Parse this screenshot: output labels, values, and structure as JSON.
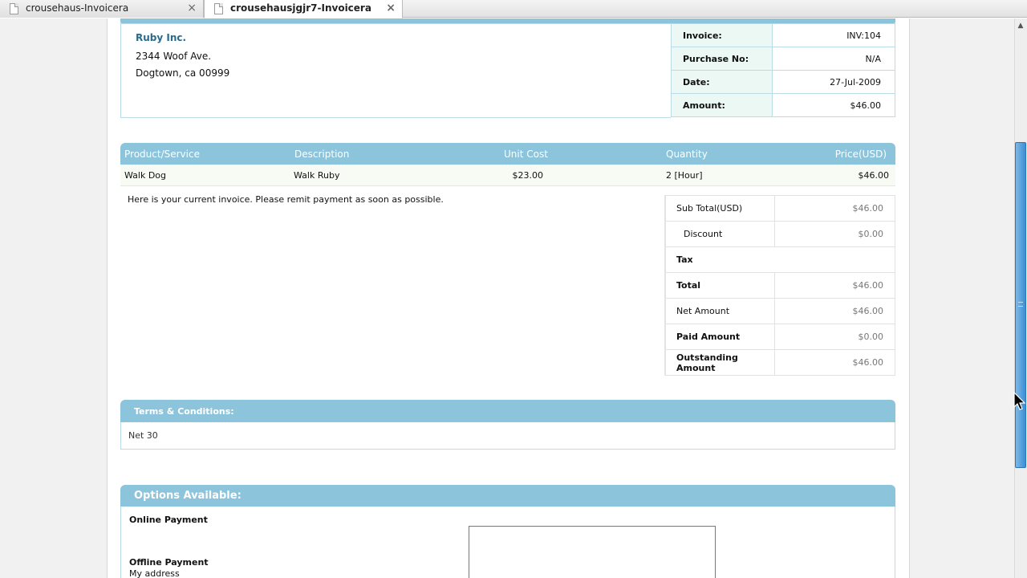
{
  "tabs": [
    {
      "label": "crousehaus-Invoicera",
      "active": false
    },
    {
      "label": "crousehausjgjr7-Invoicera",
      "active": true
    }
  ],
  "company": {
    "name": "Ruby Inc.",
    "address_line1": "2344 Woof Ave.",
    "address_line2": "Dogtown, ca 00999"
  },
  "invoice_info": [
    {
      "label": "Invoice:",
      "value": "INV:104"
    },
    {
      "label": "Purchase No:",
      "value": "N/A"
    },
    {
      "label": "Date:",
      "value": "27-Jul-2009"
    },
    {
      "label": "Amount:",
      "value": "$46.00"
    }
  ],
  "items": {
    "headers": {
      "product": "Product/Service",
      "description": "Description",
      "unit_cost": "Unit Cost",
      "quantity": "Quantity",
      "price": "Price(USD)"
    },
    "rows": [
      {
        "product": "Walk Dog",
        "description": "Walk Ruby",
        "unit_cost": "$23.00",
        "quantity": "2 [Hour]",
        "price": "$46.00"
      }
    ]
  },
  "note": "Here is your current invoice. Please remit payment as soon as possible.",
  "totals": [
    {
      "label": "Sub Total(USD)",
      "value": "$46.00",
      "bold": false,
      "indent": false
    },
    {
      "label": "Discount",
      "value": "$0.00",
      "bold": false,
      "indent": true
    },
    {
      "label": "Tax",
      "value": "",
      "bold": true,
      "indent": false
    },
    {
      "label": "Total",
      "value": "$46.00",
      "bold": true,
      "indent": false
    },
    {
      "label": "Net Amount",
      "value": "$46.00",
      "bold": false,
      "indent": false
    },
    {
      "label": "Paid Amount",
      "value": "$0.00",
      "bold": true,
      "indent": false
    },
    {
      "label": "Outstanding Amount",
      "value": "$46.00",
      "bold": true,
      "indent": false
    }
  ],
  "terms": {
    "title": "Terms & Conditions:",
    "text": "Net 30"
  },
  "options": {
    "title": "Options Available:",
    "online_payment": "Online Payment",
    "offline_payment": "Offline Payment",
    "offline_text": "My address"
  },
  "colors": {
    "header_bar": "#8cc4dc",
    "info_label_bg": "#ebf8f3",
    "company_name": "#2a6a8a",
    "scroll_thumb": "#3a8fd6"
  }
}
